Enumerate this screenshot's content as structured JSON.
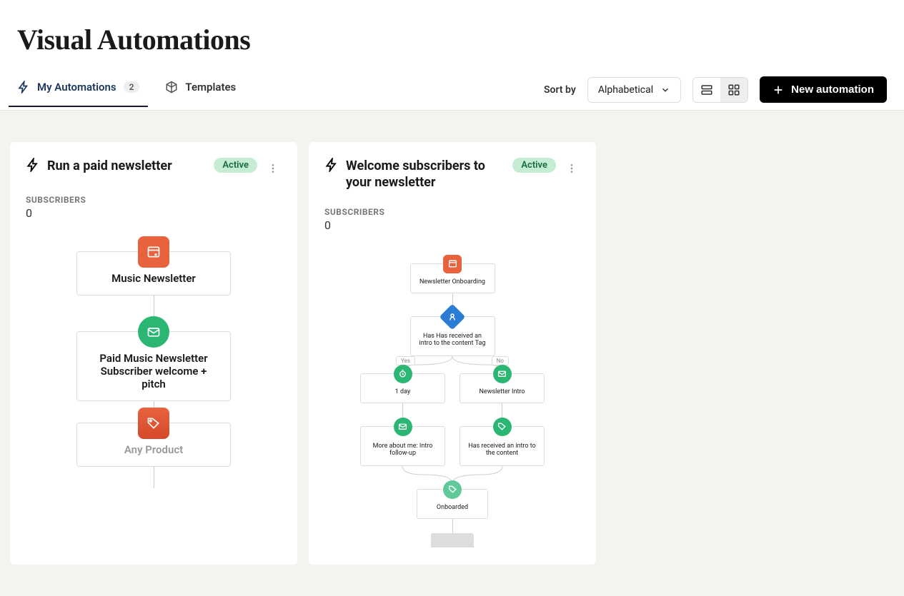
{
  "page_title": "Visual Automations",
  "tabs": {
    "my_automations": {
      "label": "My Automations",
      "count": "2"
    },
    "templates": {
      "label": "Templates"
    }
  },
  "sort": {
    "label": "Sort by",
    "selected": "Alphabetical"
  },
  "new_button": "New automation",
  "cards": [
    {
      "title": "Run a paid newsletter",
      "status": "Active",
      "subscribers_label": "SUBSCRIBERS",
      "subscribers_value": "0",
      "flow": {
        "node1": "Music Newsletter",
        "node2": "Paid Music Newsletter Subscriber welcome + pitch",
        "node3": "Any Product"
      }
    },
    {
      "title": "Welcome subscribers to your newsletter",
      "status": "Active",
      "subscribers_label": "SUBSCRIBERS",
      "subscribers_value": "0",
      "flow": {
        "node1": "Newsletter Onboarding",
        "node2": "Has Has received an intro to the content Tag",
        "yes": "Yes",
        "no": "No",
        "node3a": "1 day",
        "node3b": "Newsletter Intro",
        "node4a": "More about me: Intro follow-up",
        "node4b": "Has received an intro to the content",
        "node5": "Onboarded"
      }
    }
  ]
}
